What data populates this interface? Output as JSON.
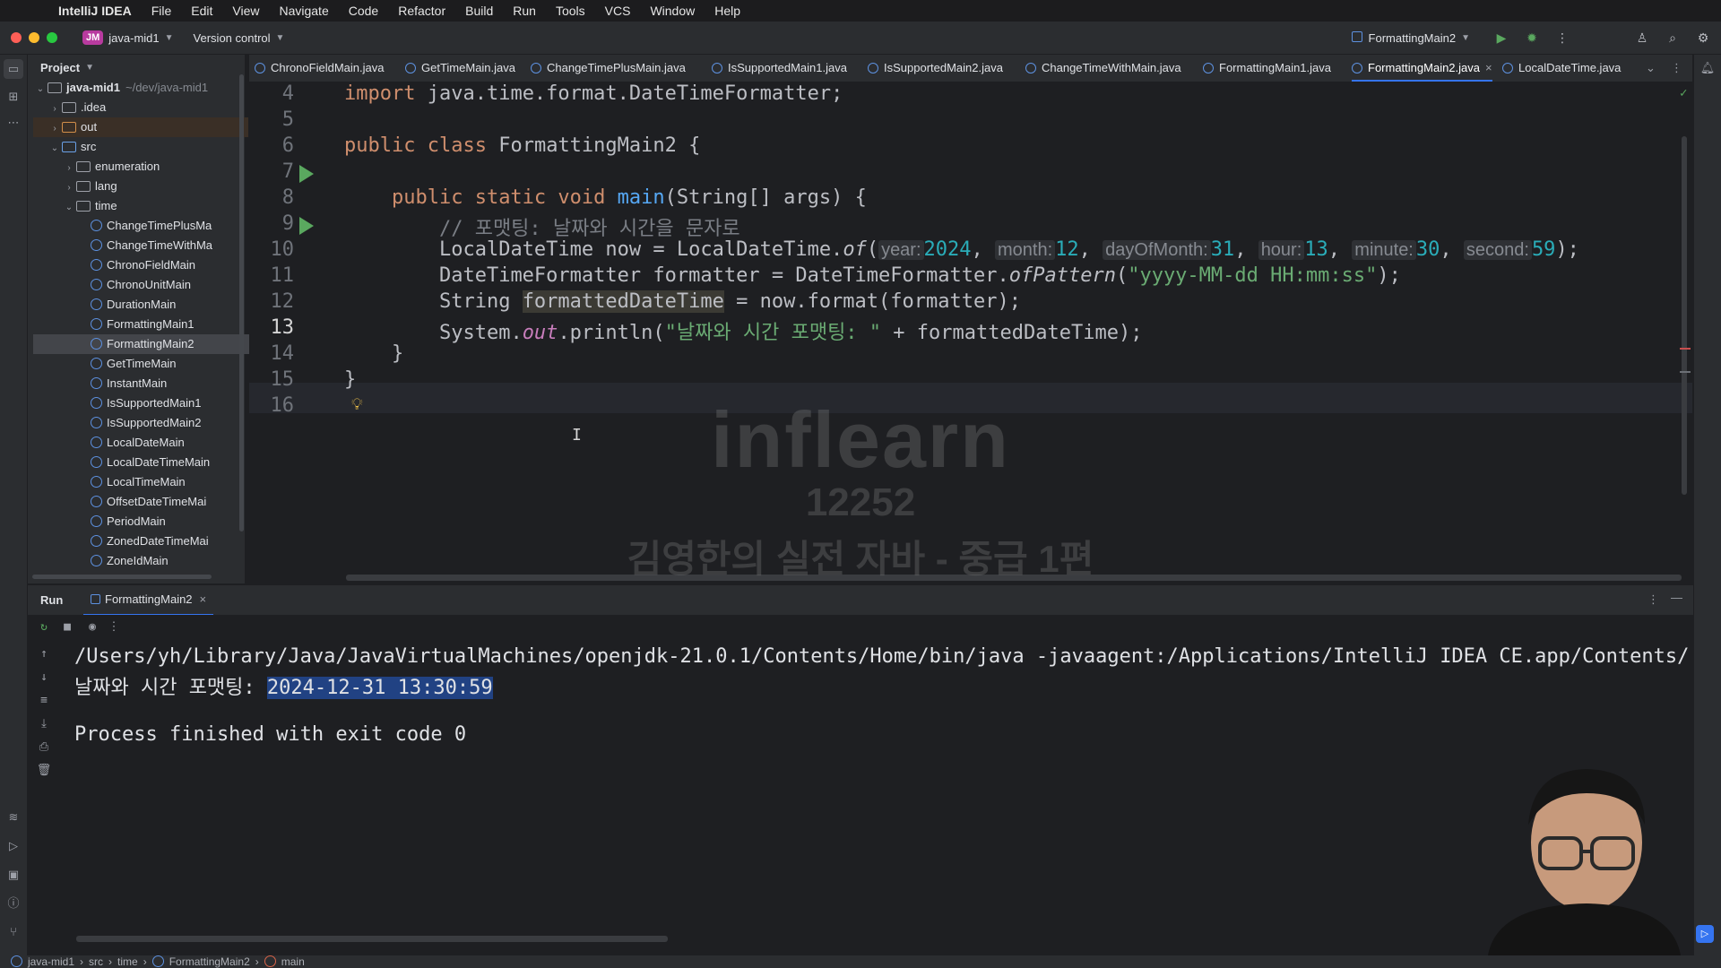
{
  "menubar": {
    "app": "IntelliJ IDEA",
    "items": [
      "File",
      "Edit",
      "View",
      "Navigate",
      "Code",
      "Refactor",
      "Build",
      "Run",
      "Tools",
      "VCS",
      "Window",
      "Help"
    ]
  },
  "titlebar": {
    "project_badge": "JM",
    "project_name": "java-mid1",
    "vcs": "Version control",
    "run_config": "FormattingMain2"
  },
  "project_panel": {
    "title": "Project",
    "root": "java-mid1",
    "root_path": "~/dev/java-mid1",
    "tree": [
      {
        "label": "java-mid1",
        "depth": 0,
        "kind": "root"
      },
      {
        "label": ".idea",
        "depth": 1,
        "kind": "folder"
      },
      {
        "label": "out",
        "depth": 1,
        "kind": "folder-orange"
      },
      {
        "label": "src",
        "depth": 1,
        "kind": "folder-blue"
      },
      {
        "label": "enumeration",
        "depth": 2,
        "kind": "folder"
      },
      {
        "label": "lang",
        "depth": 2,
        "kind": "folder"
      },
      {
        "label": "time",
        "depth": 2,
        "kind": "folder"
      },
      {
        "label": "ChangeTimePlusMa",
        "depth": 3,
        "kind": "class"
      },
      {
        "label": "ChangeTimeWithMa",
        "depth": 3,
        "kind": "class"
      },
      {
        "label": "ChronoFieldMain",
        "depth": 3,
        "kind": "class"
      },
      {
        "label": "ChronoUnitMain",
        "depth": 3,
        "kind": "class"
      },
      {
        "label": "DurationMain",
        "depth": 3,
        "kind": "class"
      },
      {
        "label": "FormattingMain1",
        "depth": 3,
        "kind": "class"
      },
      {
        "label": "FormattingMain2",
        "depth": 3,
        "kind": "class",
        "selected": true
      },
      {
        "label": "GetTimeMain",
        "depth": 3,
        "kind": "class"
      },
      {
        "label": "InstantMain",
        "depth": 3,
        "kind": "class"
      },
      {
        "label": "IsSupportedMain1",
        "depth": 3,
        "kind": "class"
      },
      {
        "label": "IsSupportedMain2",
        "depth": 3,
        "kind": "class"
      },
      {
        "label": "LocalDateMain",
        "depth": 3,
        "kind": "class"
      },
      {
        "label": "LocalDateTimeMain",
        "depth": 3,
        "kind": "class"
      },
      {
        "label": "LocalTimeMain",
        "depth": 3,
        "kind": "class"
      },
      {
        "label": "OffsetDateTimeMai",
        "depth": 3,
        "kind": "class"
      },
      {
        "label": "PeriodMain",
        "depth": 3,
        "kind": "class"
      },
      {
        "label": "ZonedDateTimeMai",
        "depth": 3,
        "kind": "class"
      },
      {
        "label": "ZoneIdMain",
        "depth": 3,
        "kind": "class"
      }
    ]
  },
  "tabs": [
    {
      "label": "ChronoFieldMain.java"
    },
    {
      "label": "GetTimeMain.java"
    },
    {
      "label": "ChangeTimePlusMain.java"
    },
    {
      "label": "IsSupportedMain1.java"
    },
    {
      "label": "IsSupportedMain2.java"
    },
    {
      "label": "ChangeTimeWithMain.java"
    },
    {
      "label": "FormattingMain1.java"
    },
    {
      "label": "FormattingMain2.java",
      "active": true
    },
    {
      "label": "LocalDateTime.java"
    }
  ],
  "editor": {
    "line_numbers": [
      "4",
      "5",
      "6",
      "7",
      "8",
      "9",
      "10",
      "11",
      "12",
      "13",
      "14",
      "15",
      "16"
    ],
    "current_line": "13",
    "l4": {
      "kw": "import",
      "rest": " java.time.format.DateTimeFormatter;"
    },
    "l6": {
      "kw1": "public",
      "kw2": "class",
      "rest": " FormattingMain2 {"
    },
    "l8": {
      "kw": "public static void",
      "fn": "main",
      "rest": "(String[] args) {"
    },
    "l9": {
      "comment": "// 포맷팅: 날짜와 시간을 문자로"
    },
    "l10": {
      "prefix": "LocalDateTime now = LocalDateTime.",
      "method": "of",
      "h_year": "year:",
      "v_year": "2024",
      "h_month": "month:",
      "v_month": "12",
      "h_day": "dayOfMonth:",
      "v_day": "31",
      "h_hour": "hour:",
      "v_hour": "13",
      "h_minute": "minute:",
      "v_minute": "30",
      "h_second": "second:",
      "v_second": "59"
    },
    "l11": {
      "prefix": "DateTimeFormatter formatter = DateTimeFormatter.",
      "method": "ofPattern",
      "str": "\"yyyy-MM-dd HH:mm:ss\"",
      "end": ");"
    },
    "l12": {
      "prefix": "String ",
      "var": "formattedDateTime",
      "rest": " = now.format(formatter);"
    },
    "l13": {
      "prefix": "System.",
      "field": "out",
      "mid": ".println(",
      "str": "\"날짜와 시간 포맷팅: \"",
      "rest": " + formattedDateTime);"
    },
    "l14": "}",
    "l15": "}"
  },
  "watermark": {
    "logo": "inflearn",
    "id": "12252",
    "course": "김영한의 실전 자바 - 중급 1편",
    "author": "김영한"
  },
  "run_panel": {
    "tab_run": "Run",
    "tab_config": "FormattingMain2",
    "output": [
      "/Users/yh/Library/Java/JavaVirtualMachines/openjdk-21.0.1/Contents/Home/bin/java -javaagent:/Applications/IntelliJ IDEA CE.app/Contents/",
      "날짜와 시간 포맷팅: ",
      "Process finished with exit code 0"
    ],
    "output_selected": "2024-12-31 13:30:59"
  },
  "statusbar": {
    "crumbs": [
      "java-mid1",
      "src",
      "time",
      "FormattingMain2",
      "main"
    ]
  },
  "colors": {
    "accent": "#3574f0",
    "keyword": "#cf8e6d",
    "string": "#6aab73",
    "number": "#2aacb8",
    "run_green": "#5aa85f"
  }
}
